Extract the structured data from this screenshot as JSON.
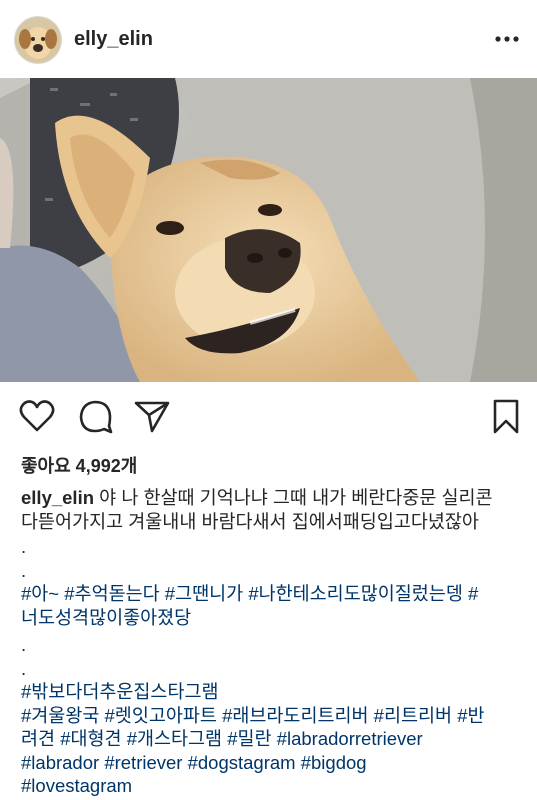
{
  "post": {
    "username": "elly_elin",
    "likes_label": "좋아요 4,992개",
    "caption_text_1": " 야 나 한살때 기억나냐 그때 내가 베란다중문 실리콘",
    "caption_text_2": "다뜯어가지고 겨울내내 바람다새서 집에서패딩입고다녔잖아",
    "dot": ".",
    "hashtags_a": [
      "#아~",
      "#추억돋는다",
      "#그땐니가",
      "#나한테소리도많이질렀는뎅",
      "#"
    ],
    "hashtags_b": [
      "너도성격많이좋아졌당"
    ],
    "hashtags_c": [
      "#밖보다더추운집스타그램"
    ],
    "hashtags_d": [
      "#겨울왕국",
      "#렛잇고아파트",
      "#래브라도리트리버",
      "#리트리버",
      "#반"
    ],
    "hashtags_e": [
      "려견",
      "#대형견",
      "#개스타그램",
      "#밀란",
      "#labradorretriever"
    ],
    "hashtags_f": [
      "#labrador",
      "#retriever",
      "#dogstagram",
      "#bigdog"
    ],
    "hashtags_g": [
      "#lovestagram"
    ]
  },
  "icons": {
    "more": "more-options-icon",
    "like": "heart-icon",
    "comment": "comment-icon",
    "share": "paper-plane-icon",
    "save": "bookmark-icon"
  },
  "colors": {
    "text": "#262626",
    "hashtag": "#003569",
    "background": "#ffffff"
  }
}
